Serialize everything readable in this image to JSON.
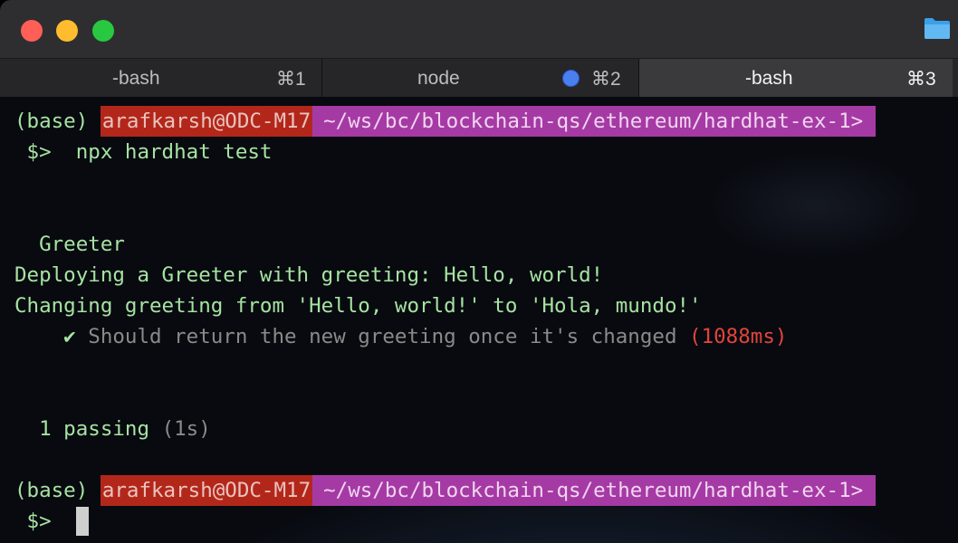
{
  "tabs": [
    {
      "label": "-bash",
      "shortcut": "⌘1"
    },
    {
      "label": "node",
      "shortcut": "⌘2"
    },
    {
      "label": "-bash",
      "shortcut": "⌘3"
    }
  ],
  "terminal": {
    "prompt1": {
      "env": "(base) ",
      "user": "arafkarsh@ODC-M17",
      "path": "~/ws/bc/blockchain-qs/ethereum/hardhat-ex-1>"
    },
    "command_line": " $>  npx hardhat test",
    "suite": "  Greeter",
    "log1": "Deploying a Greeter with greeting: Hello, world!",
    "log2": "Changing greeting from 'Hello, world!' to 'Hola, mundo!'",
    "test_check": "    ✔ ",
    "test_name": "Should return the new greeting once it's changed ",
    "test_time": "(1088ms)",
    "passing_count": "  1 passing ",
    "passing_time": "(1s)",
    "prompt2": {
      "env": "(base) ",
      "user": "arafkarsh@ODC-M17",
      "path": "~/ws/bc/blockchain-qs/ethereum/hardhat-ex-1>"
    },
    "prompt_symbol": " $>  "
  },
  "colors": {
    "user_segment": "#b3271a",
    "path_segment": "#a63aa5",
    "text_green": "#a6e3a1",
    "duration_red": "#e0453a",
    "tab_active_indicator": "#4a7ff0"
  },
  "icons": [
    "close-traffic-light",
    "minimize-traffic-light",
    "zoom-traffic-light",
    "folder-icon",
    "activity-dot-icon"
  ]
}
